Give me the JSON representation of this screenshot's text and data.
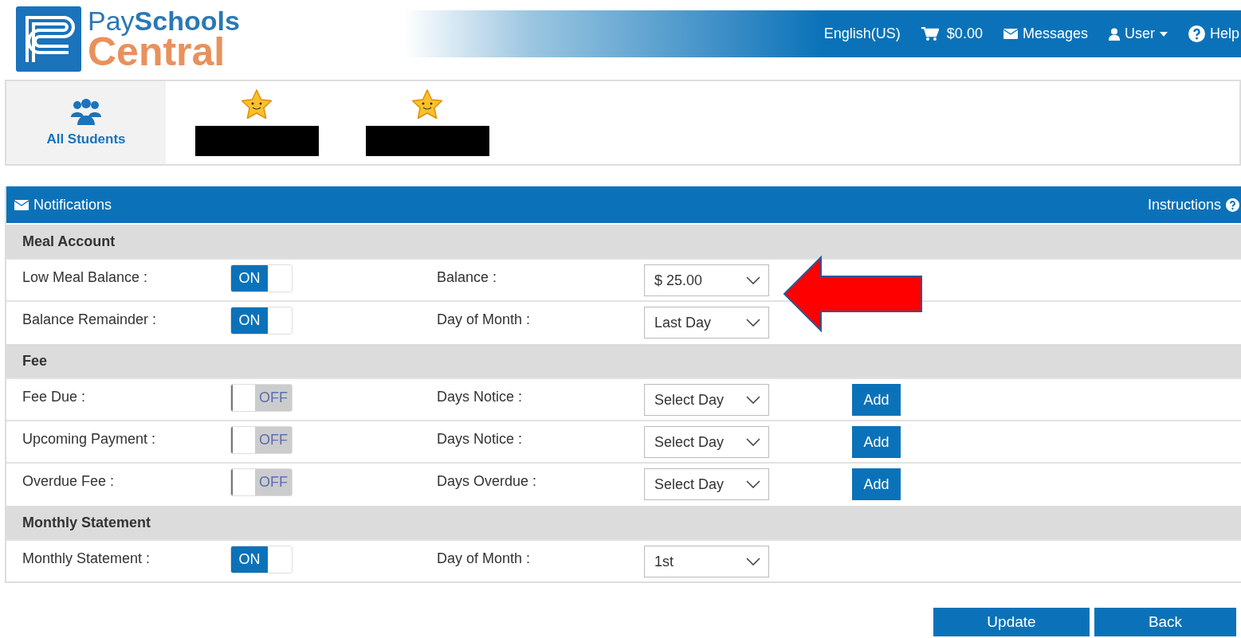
{
  "logo": {
    "pay": "Pay",
    "schools": "Schools",
    "central": "Central"
  },
  "top_nav": [
    {
      "kind": "text",
      "label": "English(US)"
    },
    {
      "kind": "cart",
      "label": "$0.00"
    },
    {
      "kind": "mail",
      "label": "Messages"
    },
    {
      "kind": "user",
      "label": "User"
    },
    {
      "kind": "help",
      "label": "Help"
    }
  ],
  "student_tabs": [
    {
      "kind": "all",
      "label": "All Students",
      "selected": true
    },
    {
      "kind": "student",
      "selected": false
    },
    {
      "kind": "student",
      "selected": false
    }
  ],
  "panel": {
    "title": "Notifications",
    "instructions": "Instructions"
  },
  "sections": [
    {
      "title": "Meal Account",
      "rows": [
        {
          "label": "Low Meal Balance :",
          "toggle": {
            "on": true,
            "text": "ON"
          },
          "field_label": "Balance :",
          "select": "$ 25.00"
        },
        {
          "label": "Balance Remainder :",
          "toggle": {
            "on": true,
            "text": "ON"
          },
          "field_label": "Day of Month :",
          "select": "Last Day"
        }
      ]
    },
    {
      "title": "Fee",
      "rows": [
        {
          "label": "Fee Due :",
          "toggle": {
            "on": false,
            "text": "OFF"
          },
          "field_label": "Days Notice :",
          "select": "Select Day",
          "button": "Add"
        },
        {
          "label": "Upcoming Payment :",
          "toggle": {
            "on": false,
            "text": "OFF"
          },
          "field_label": "Days Notice :",
          "select": "Select Day",
          "button": "Add"
        },
        {
          "label": "Overdue Fee :",
          "toggle": {
            "on": false,
            "text": "OFF"
          },
          "field_label": "Days Overdue :",
          "select": "Select Day",
          "button": "Add"
        }
      ]
    },
    {
      "title": "Monthly Statement",
      "rows": [
        {
          "label": "Monthly Statement :",
          "toggle": {
            "on": true,
            "text": "ON"
          },
          "field_label": "Day of Month :",
          "select": "1st"
        }
      ]
    }
  ],
  "footer_buttons": [
    "Update",
    "Back"
  ]
}
